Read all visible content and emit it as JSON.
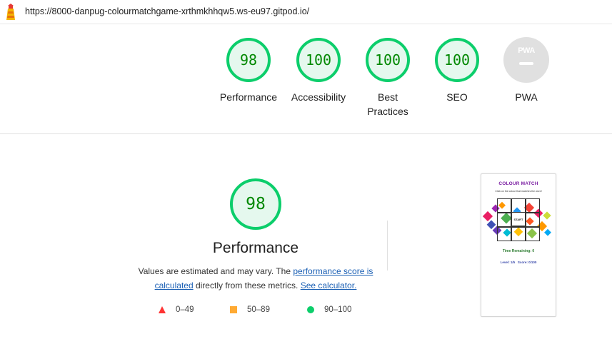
{
  "browser": {
    "url": "https://8000-danpug-colourmatchgame-xrthmkhhqw5.ws-eu97.gitpod.io/"
  },
  "colors": {
    "pass_green": "#0cce6b",
    "pass_text": "#008800",
    "pass_fill": "#e5f8ee",
    "average_orange": "#ffaa33",
    "fail_red": "#ff3333",
    "pwa_gray": "#e0e0e0",
    "link_blue": "#1a5fb4"
  },
  "summary_gauges": [
    {
      "score": "98",
      "label": "Performance"
    },
    {
      "score": "100",
      "label": "Accessibility"
    },
    {
      "score": "100",
      "label": "Best Practices"
    },
    {
      "score": "100",
      "label": "SEO"
    }
  ],
  "pwa_gauge": {
    "badge_text": "PWA",
    "label": "PWA"
  },
  "performance": {
    "score": "98",
    "title": "Performance",
    "desc_prefix": "Values are estimated and may vary. The ",
    "link_score": "performance score is calculated",
    "desc_middle": " directly from these metrics. ",
    "link_calculator": "See calculator."
  },
  "legend": {
    "fail": {
      "icon": "triangle-icon",
      "range": "0–49"
    },
    "average": {
      "icon": "square-icon",
      "range": "50–89"
    },
    "pass": {
      "icon": "circle-icon",
      "range": "90–100"
    }
  },
  "thumbnail": {
    "title": "COLOUR MATCH",
    "subtitle": "Click on the colour that matches the word!",
    "start_label": "START",
    "time_label": "Time Remaining: 0",
    "level_label": "Level: 1/5",
    "score_label": "Score: 0/100"
  }
}
